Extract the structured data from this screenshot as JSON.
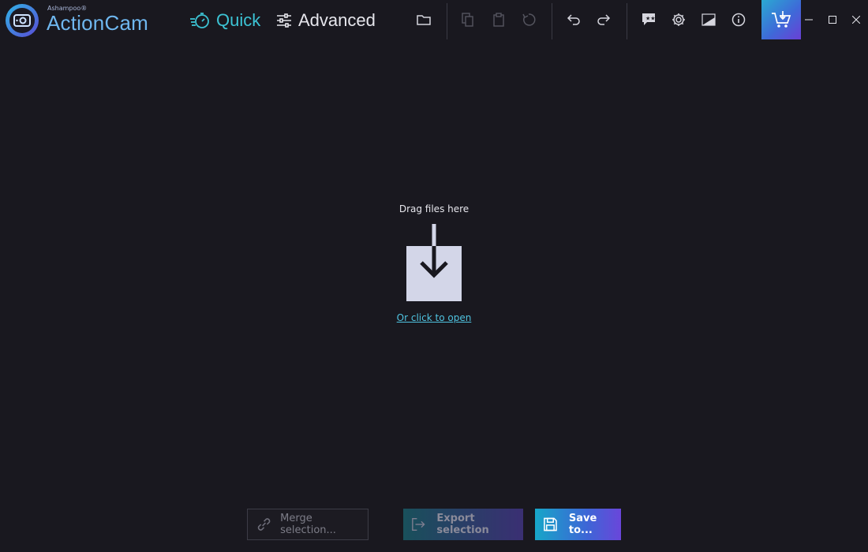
{
  "app": {
    "brand_small": "Ashampoo®",
    "brand": "ActionCam"
  },
  "modes": {
    "quick": "Quick",
    "advanced": "Advanced"
  },
  "toolbar": {
    "icons": [
      "folder-icon",
      "copy-icon",
      "clipboard-icon",
      "rotate-icon",
      "undo-icon",
      "redo-icon",
      "feedback-icon",
      "gear-icon",
      "wallpaper-icon",
      "info-icon",
      "cart-icon",
      "minimize-icon",
      "maximize-icon",
      "close-icon"
    ]
  },
  "dropzone": {
    "label": "Drag files here",
    "open_link": "Or click to open"
  },
  "actions": {
    "merge": "Merge selection...",
    "export": "Export selection",
    "save": "Save to..."
  },
  "colors": {
    "background": "#19181f",
    "accent": "#3cc3d4",
    "gradient_start": "#17a6c8",
    "gradient_end": "#6a46da"
  }
}
